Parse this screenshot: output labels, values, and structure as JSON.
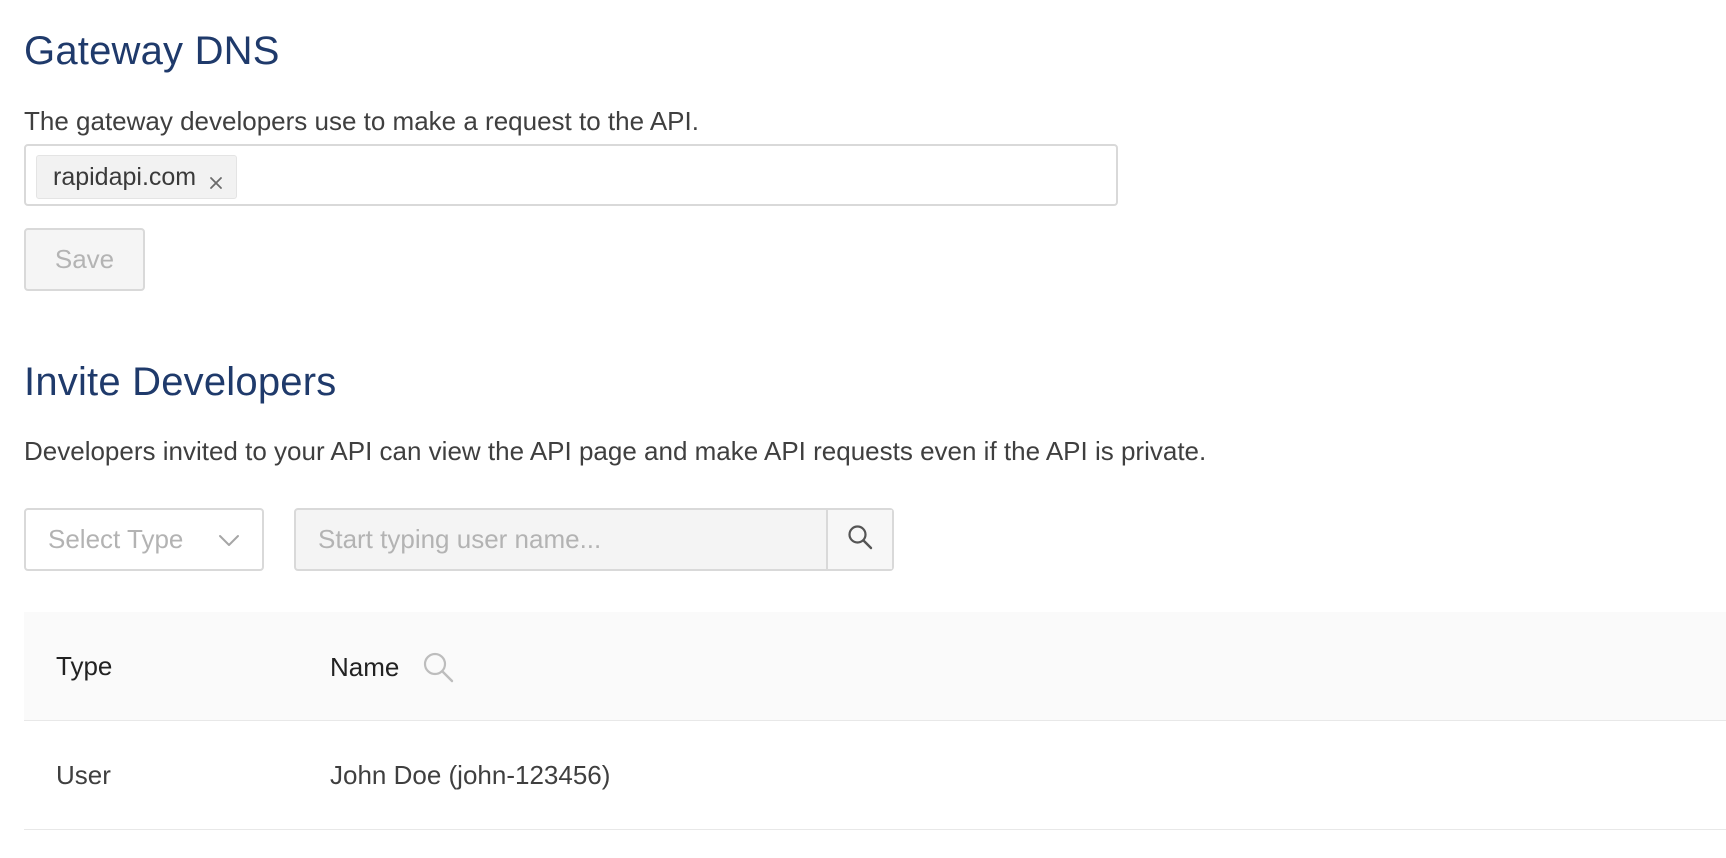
{
  "gateway": {
    "title": "Gateway DNS",
    "description": "The gateway developers use to make a request to the API.",
    "tags": [
      "rapidapi.com"
    ],
    "save_label": "Save"
  },
  "invite": {
    "title": "Invite Developers",
    "description": "Developers invited to your API can view the API page and make API requests even if the API is private.",
    "select_placeholder": "Select Type",
    "search_placeholder": "Start typing user name...",
    "table": {
      "columns": [
        "Type",
        "Name"
      ],
      "rows": [
        {
          "type": "User",
          "name": "John Doe (john-123456)"
        }
      ]
    }
  },
  "icons": {
    "tag_remove": "close-icon",
    "select_toggle": "chevron-down-icon",
    "search": "search-icon",
    "column_search": "search-icon"
  },
  "colors": {
    "heading": "#1f3a6b",
    "border": "#d9d9d9",
    "header_bg": "#fafafa"
  }
}
